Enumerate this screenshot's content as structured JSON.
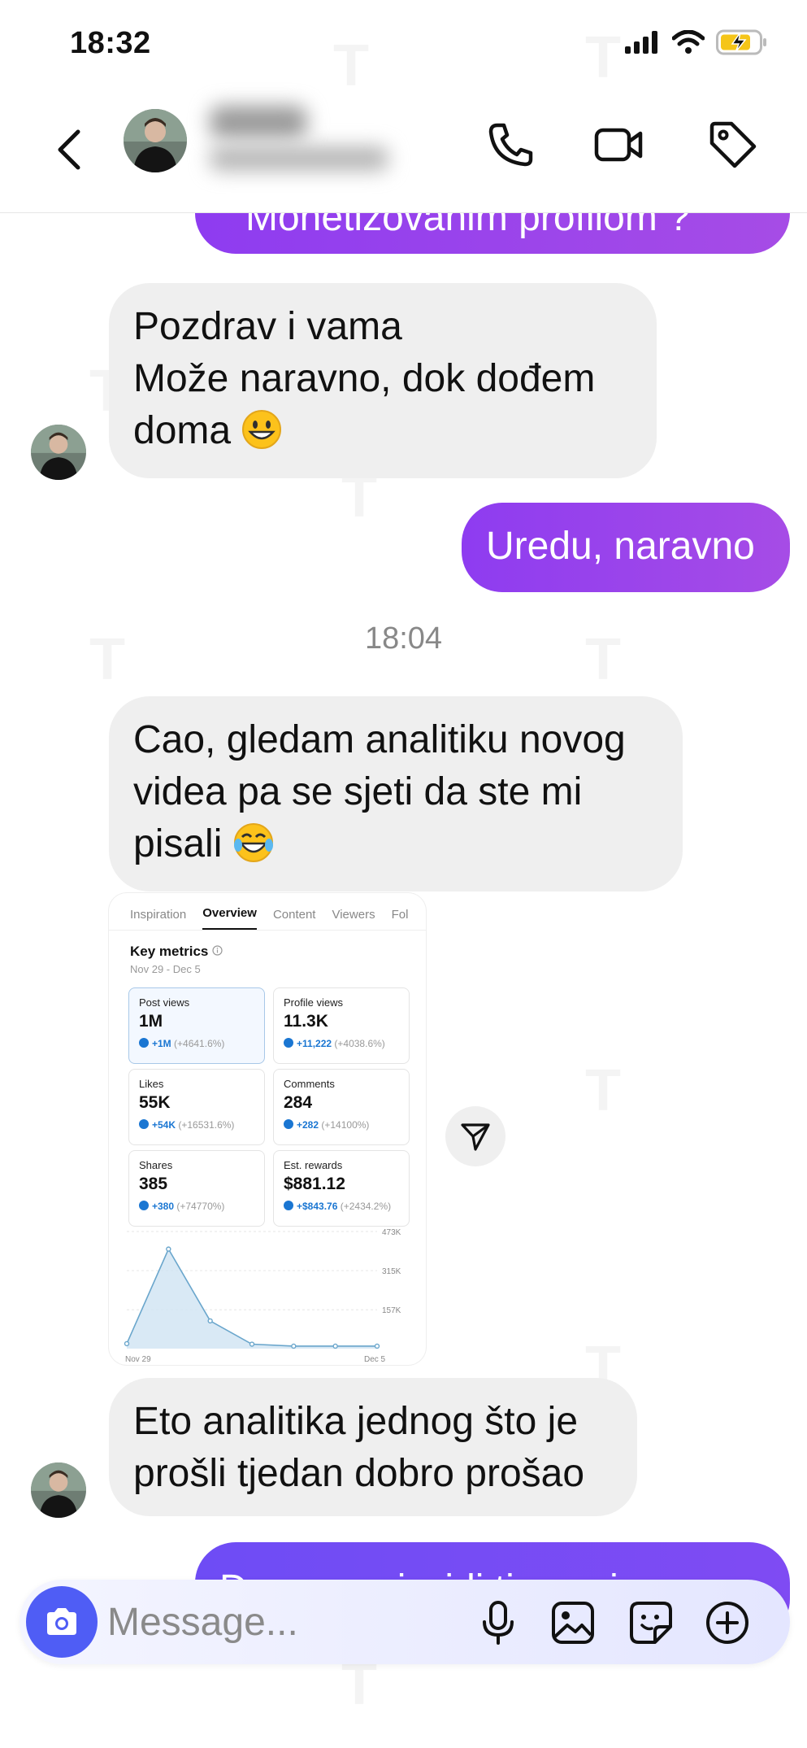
{
  "status_bar": {
    "time": "18:32"
  },
  "header": {
    "contact_name": "",
    "contact_subtitle": ""
  },
  "messages": {
    "outgoing_partial_top": "Monetizovanim profilom ?",
    "incoming_1": [
      "Pozdrav i vama",
      "Može naravno, dok dođem",
      "doma"
    ],
    "outgoing_1": "Uredu, naravno",
    "timestamp": "18:04",
    "incoming_2": [
      "Cao, gledam analitiku novog",
      "videa pa se sjeti da ste mi",
      "pisali"
    ],
    "incoming_3": [
      "Eto analitika jednog što je",
      "prošli tjedan dobro prošao"
    ],
    "outgoing_partial_bottom": "Da sam u izvidi tim se iza"
  },
  "screenshot": {
    "tabs": [
      "Inspiration",
      "Overview",
      "Content",
      "Viewers",
      "Fol"
    ],
    "active_tab": "Overview",
    "title": "Key metrics",
    "date_range": "Nov 29 - Dec 5",
    "metrics": [
      {
        "label": "Post views",
        "value": "1M",
        "change": "+1M",
        "pct": "(+4641.6%)"
      },
      {
        "label": "Profile views",
        "value": "11.3K",
        "change": "+11,222",
        "pct": "(+4038.6%)"
      },
      {
        "label": "Likes",
        "value": "55K",
        "change": "+54K",
        "pct": "(+16531.6%)"
      },
      {
        "label": "Comments",
        "value": "284",
        "change": "+282",
        "pct": "(+14100%)"
      },
      {
        "label": "Shares",
        "value": "385",
        "change": "+380",
        "pct": "(+74770%)"
      },
      {
        "label": "Est. rewards",
        "value": "$881.12",
        "change": "+$843.76",
        "pct": "(+2434.2%)"
      }
    ],
    "chart_y_ticks": [
      "473K",
      "315K",
      "157K"
    ],
    "chart_x_ticks": [
      "Nov 29",
      "Dec 5"
    ]
  },
  "chart_data": {
    "type": "area",
    "x": [
      "Nov 29",
      "Nov 30",
      "Dec 1",
      "Dec 2",
      "Dec 3",
      "Dec 4",
      "Dec 5"
    ],
    "values": [
      20000,
      402000,
      112000,
      18000,
      10000,
      10000,
      10000
    ],
    "yticks": [
      157000,
      315000,
      473000
    ],
    "ylim": [
      0,
      473000
    ]
  },
  "composer": {
    "placeholder": "Message..."
  }
}
